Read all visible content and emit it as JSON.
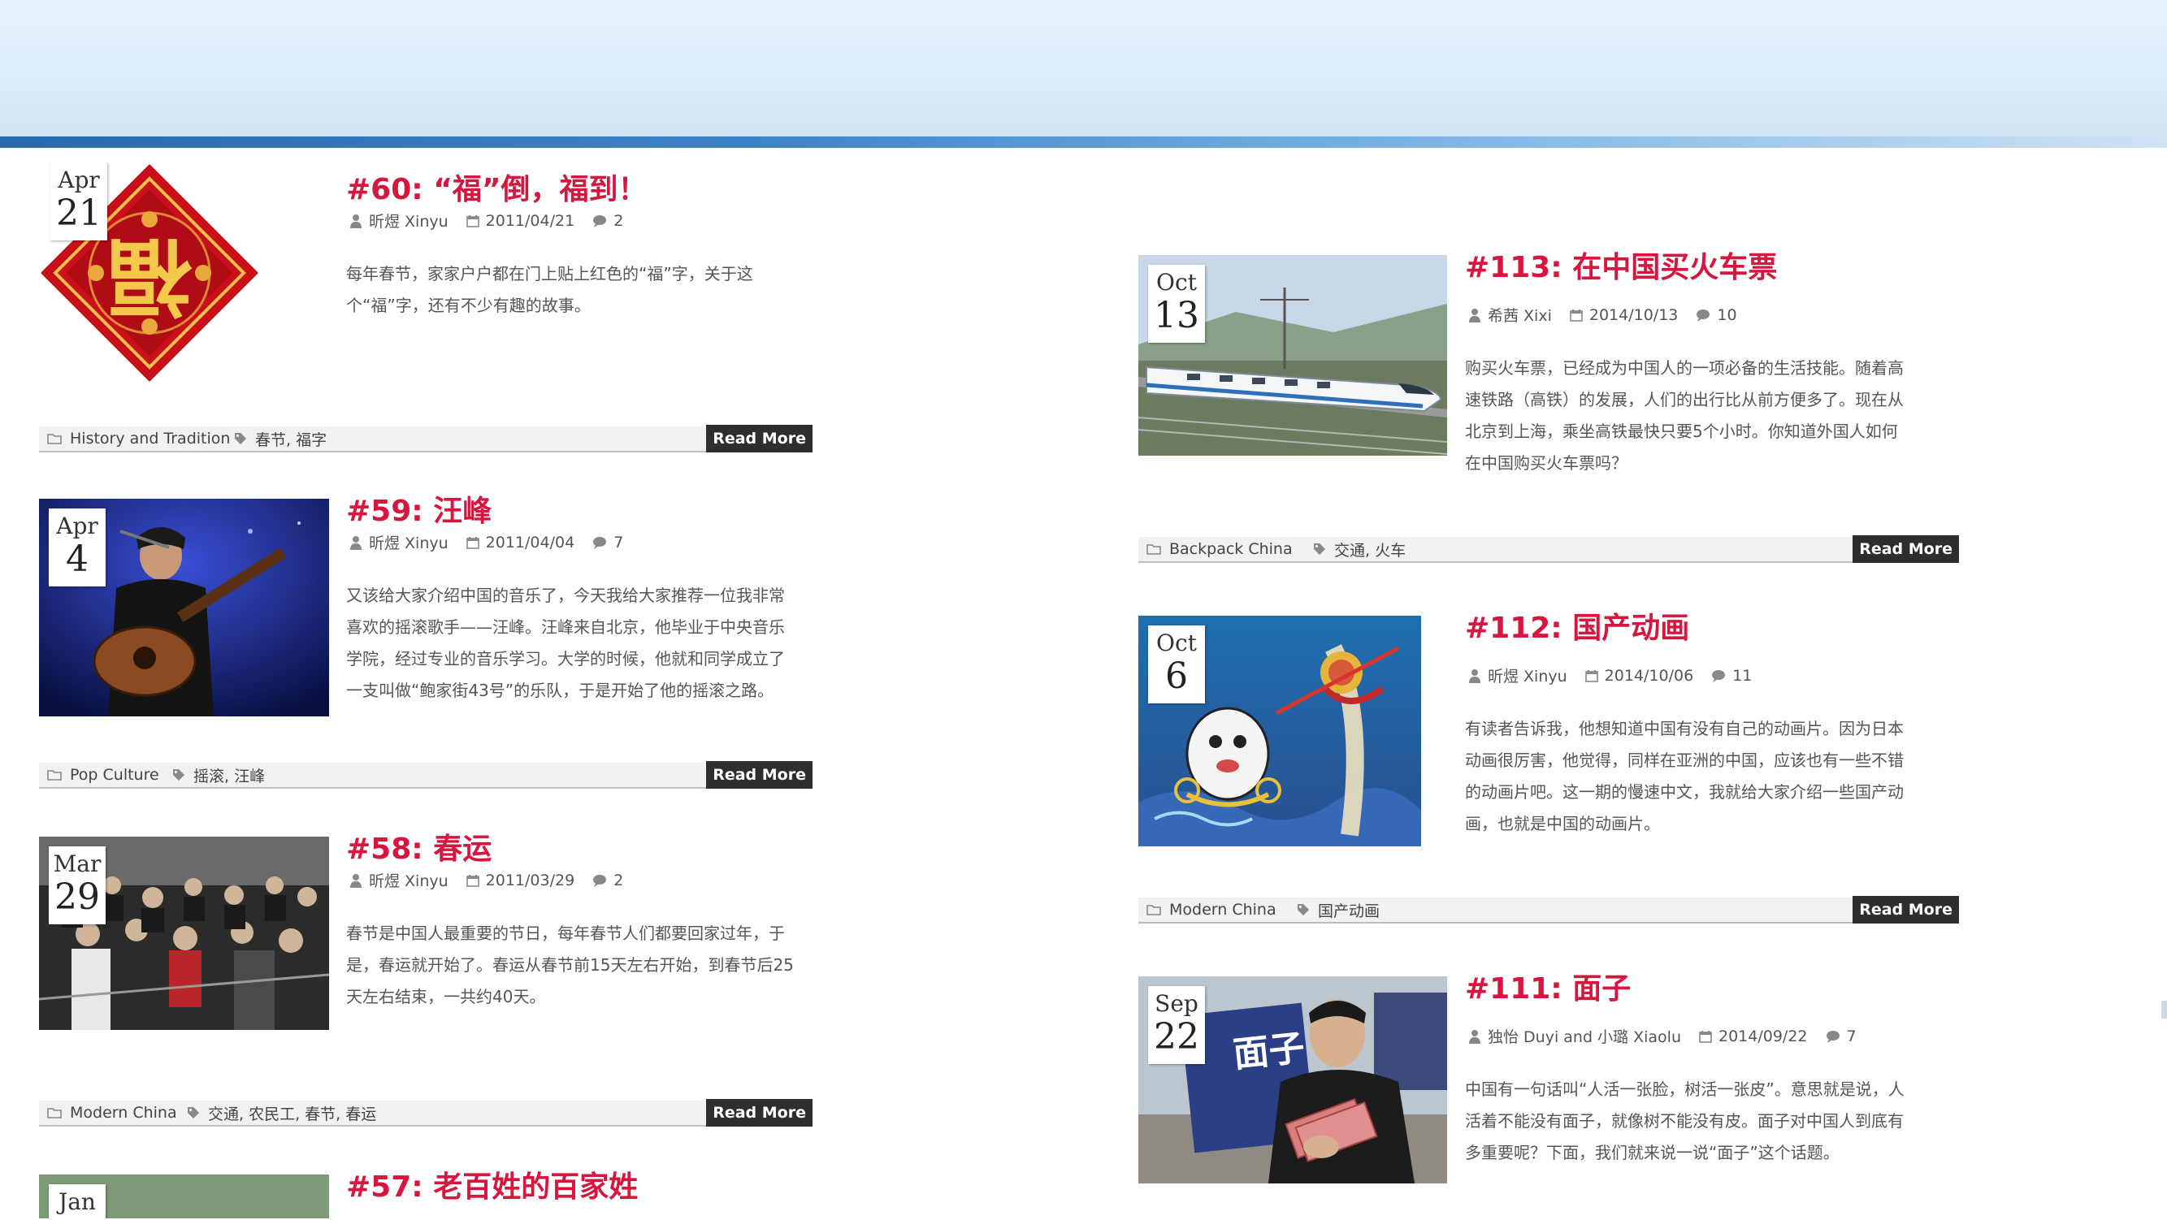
{
  "colors": {
    "accent_title": "#d6163e",
    "banner_bar": "#2a69b0",
    "read_more_bg": "#2e2e2e"
  },
  "icons": {
    "author": "person-icon",
    "date": "calendar-icon",
    "comments": "comment-bubble-icon",
    "category": "folder-icon",
    "tags": "tag-icon"
  },
  "posts_left": [
    {
      "month": "Apr",
      "day": "21",
      "title": "#60: “福”倒，福到！",
      "author": "昕煜 Xinyu",
      "date": "2011/04/21",
      "comments": "2",
      "excerpt": [
        "每年春节，家家户户都在门上贴上红色的“福”字，关于这",
        "个“福”字，还有不少有趣的故事。"
      ],
      "category": "History and Tradition",
      "tags": "春节, 福字",
      "read_more": "Read More"
    },
    {
      "month": "Apr",
      "day": "4",
      "title": "#59: 汪峰",
      "author": "昕煜 Xinyu",
      "date": "2011/04/04",
      "comments": "7",
      "excerpt": [
        "又该给大家介绍中国的音乐了，今天我给大家推荐一位我非常",
        "喜欢的摇滚歌手——汪峰。汪峰来自北京，他毕业于中央音乐",
        "学院，经过专业的音乐学习。大学的时候，他就和同学成立了",
        "一支叫做“鲍家街43号”的乐队，于是开始了他的摇滚之路。"
      ],
      "category": "Pop Culture",
      "tags": "摇滚, 汪峰",
      "read_more": "Read More"
    },
    {
      "month": "Mar",
      "day": "29",
      "title": "#58: 春运",
      "author": "昕煜 Xinyu",
      "date": "2011/03/29",
      "comments": "2",
      "excerpt": [
        "春节是中国人最重要的节日，每年春节人们都要回家过年，于",
        "是，春运就开始了。春运从春节前15天左右开始，到春节后25",
        "天左右结束，一共约40天。"
      ],
      "category": "Modern China",
      "tags": "交通, 农民工, 春节, 春运",
      "read_more": "Read More"
    },
    {
      "month": "Jan",
      "day": "",
      "title": "#57: 老百姓的百家姓"
    }
  ],
  "posts_right": [
    {
      "month": "Oct",
      "day": "13",
      "title": "#113: 在中国买火车票",
      "author": "希茜 Xixi",
      "date": "2014/10/13",
      "comments": "10",
      "excerpt": [
        "购买火车票，已经成为中国人的一项必备的生活技能。随着高",
        "速铁路（高铁）的发展，人们的出行比从前方便多了。现在从",
        "北京到上海，乘坐高铁最快只要5个小时。你知道外国人如何",
        "在中国购买火车票吗？"
      ],
      "category": "Backpack China",
      "tags": "交通, 火车",
      "read_more": "Read More"
    },
    {
      "month": "Oct",
      "day": "6",
      "title": "#112: 国产动画",
      "author": "昕煜 Xinyu",
      "date": "2014/10/06",
      "comments": "11",
      "excerpt": [
        "有读者告诉我，他想知道中国有没有自己的动画片。因为日本",
        "动画很厉害，他觉得，同样在亚洲的中国，应该也有一些不错",
        "的动画片吧。这一期的慢速中文，我就给大家介绍一些国产动",
        "画，也就是中国的动画片。"
      ],
      "category": "Modern China",
      "tags": "国产动画",
      "read_more": "Read More"
    },
    {
      "month": "Sep",
      "day": "22",
      "title": "#111: 面子",
      "author": "独怡 Duyi and 小璐 Xiaolu",
      "date": "2014/09/22",
      "comments": "7",
      "excerpt": [
        "中国有一句话叫“人活一张脸，树活一张皮”。意思就是说，人",
        "活着不能没有面子，就像树不能没有皮。面子对中国人到底有",
        "多重要呢？下面，我们就来说一说“面子”这个话题。"
      ]
    }
  ],
  "image_text": {
    "fu_character": "福",
    "mianzi_sign": "面子"
  }
}
